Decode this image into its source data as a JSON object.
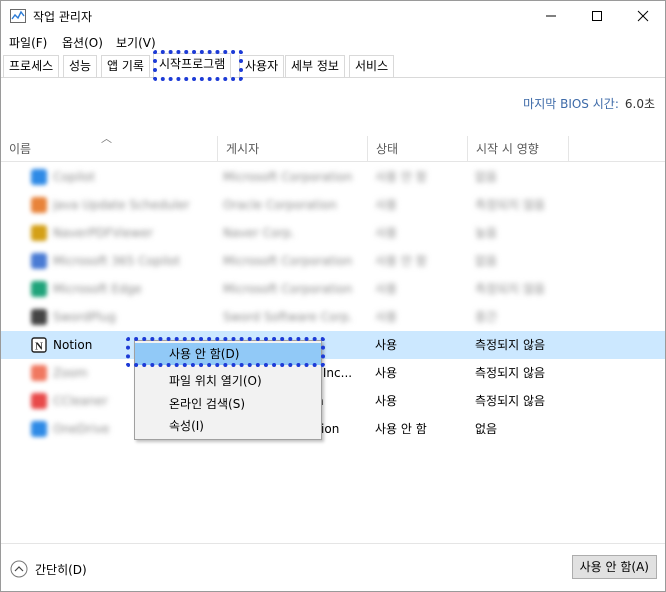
{
  "window": {
    "title": "작업 관리자"
  },
  "menu": [
    "파일(F)",
    "옵션(O)",
    "보기(V)"
  ],
  "tabs": [
    "프로세스",
    "성능",
    "앱 기록",
    "시작프로그램",
    "사용자",
    "세부 정보",
    "서비스"
  ],
  "bios": {
    "label": "마지막 BIOS 시간:",
    "value": "6.0초"
  },
  "columns": [
    "이름",
    "게시자",
    "상태",
    "시작 시 영향"
  ],
  "rows": [
    {
      "name": "Copilot",
      "publisher": "Microsoft Corporation",
      "status": "사용 안 함",
      "impact": "없음",
      "color": "#2e8ae6",
      "blurred": true
    },
    {
      "name": "Java Update Scheduler",
      "publisher": "Oracle Corporation",
      "status": "사용",
      "impact": "측정되지 않음",
      "color": "#e8833a",
      "blurred": true
    },
    {
      "name": "NaverPDFViewer",
      "publisher": "Naver Corp.",
      "status": "사용",
      "impact": "높음",
      "color": "#d4a017",
      "blurred": true
    },
    {
      "name": "Microsoft 365 Copilot",
      "publisher": "Microsoft Corporation",
      "status": "사용 안 함",
      "impact": "없음",
      "color": "#4a7bd4",
      "blurred": true
    },
    {
      "name": "Microsoft Edge",
      "publisher": "Microsoft Corporation",
      "status": "사용",
      "impact": "측정되지 않음",
      "color": "#1fa37a",
      "blurred": true
    },
    {
      "name": "SwordPlug",
      "publisher": "Sword Software Corp.",
      "status": "사용",
      "impact": "중간",
      "color": "#444444",
      "blurred": true
    },
    {
      "name": "Notion",
      "publisher": "",
      "status": "사용",
      "impact": "측정되지 않음",
      "color": "#222222",
      "blurred": false,
      "selected": true
    },
    {
      "name": "Zoom",
      "publisher": "s, Inc...",
      "status": "사용",
      "impact": "측정되지 않음",
      "color": "#f07860",
      "blurred": true,
      "publisher_tail": "s, Inc..."
    },
    {
      "name": "CCleaner",
      "publisher": "n",
      "status": "사용",
      "impact": "측정되지 않음",
      "color": "#e84a4a",
      "blurred": true,
      "publisher_tail": "n"
    },
    {
      "name": "OneDrive",
      "publisher": "ation",
      "status": "사용 안 함",
      "impact": "없음",
      "color": "#2e8ae6",
      "blurred": true,
      "publisher_tail": "ation"
    }
  ],
  "context_menu": [
    "사용 안 함(D)",
    "파일 위치 열기(O)",
    "온라인 검색(S)",
    "속성(I)"
  ],
  "footer": {
    "collapse_label": "간단히(D)",
    "disable_button": "사용 안 함(A)"
  },
  "colors": {
    "selected_row": "#cce8ff",
    "menu_highlight": "#91c9f7",
    "annotation": "#1d3bd6"
  }
}
